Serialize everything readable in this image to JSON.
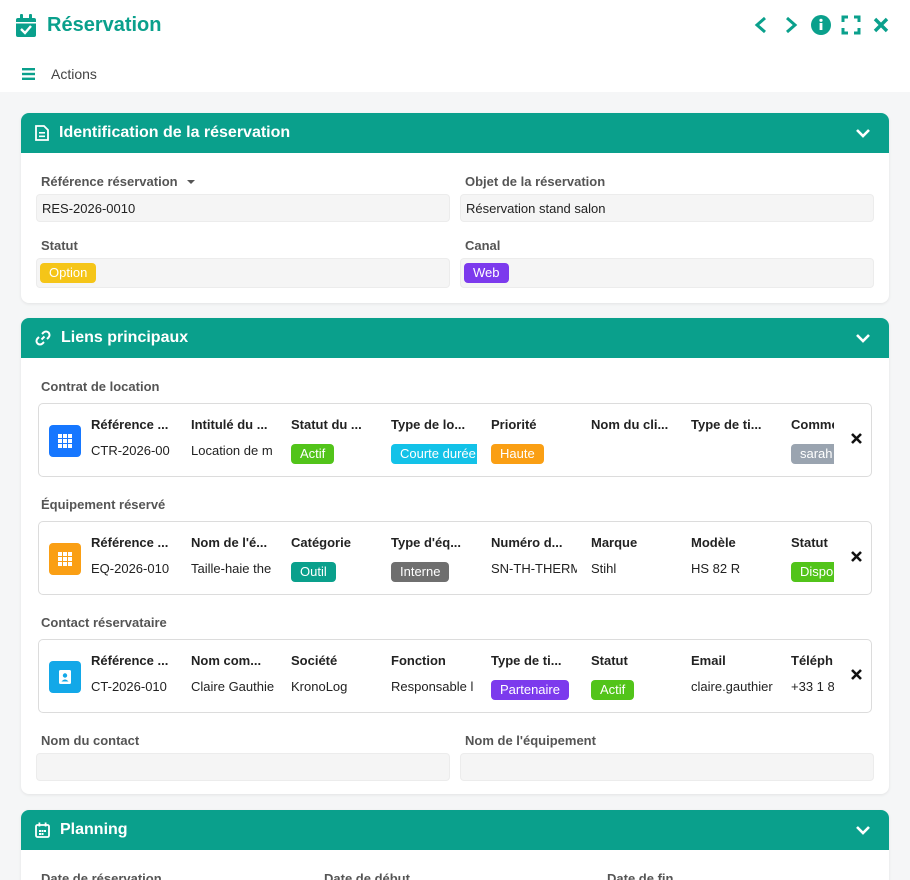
{
  "header": {
    "title": "Réservation",
    "actions_label": "Actions",
    "icons": [
      "calendar-check-icon",
      "chevron-left-icon",
      "chevron-right-icon",
      "info-icon",
      "expand-icon",
      "close-icon"
    ]
  },
  "colors": {
    "accent": "#0aa08c",
    "yellow": "#f5c518",
    "purple": "#7c3aed",
    "green": "#52c41a",
    "cyan": "#13c2e8",
    "orange": "#fa9f14",
    "gray": "#7a7a7a",
    "slate": "#9aa4b0",
    "blue": "#1677ff"
  },
  "identification": {
    "title": "Identification de la réservation",
    "ref_label": "Référence réservation",
    "ref_value": "RES-2026-0010",
    "objet_label": "Objet de la réservation",
    "objet_value": "Réservation stand salon",
    "statut_label": "Statut",
    "statut_value": "Option",
    "canal_label": "Canal",
    "canal_value": "Web"
  },
  "liens": {
    "title": "Liens principaux",
    "contrat": {
      "label": "Contrat de location",
      "columns": [
        {
          "h": "Référence ...",
          "v": "CTR-2026-00"
        },
        {
          "h": "Intitulé du ...",
          "v": "Location de m"
        },
        {
          "h": "Statut du ...",
          "badge": "Actif",
          "color": "#52c41a"
        },
        {
          "h": "Type de lo...",
          "badge": "Courte durée",
          "color": "#13c2e8"
        },
        {
          "h": "Priorité",
          "badge": "Haute",
          "color": "#fa9f14"
        },
        {
          "h": "Nom du cli...",
          "v": ""
        },
        {
          "h": "Type de ti...",
          "v": ""
        },
        {
          "h": "Comme",
          "badge": "sarah",
          "color": "#9aa4b0"
        }
      ]
    },
    "equipement": {
      "label": "Équipement réservé",
      "columns": [
        {
          "h": "Référence ...",
          "v": "EQ-2026-010"
        },
        {
          "h": "Nom de l'é...",
          "v": "Taille-haie the"
        },
        {
          "h": "Catégorie",
          "badge": "Outil",
          "color": "#0aa08c"
        },
        {
          "h": "Type d'éq...",
          "badge": "Interne",
          "color": "#6f6f6f"
        },
        {
          "h": "Numéro d...",
          "v": "SN-TH-THERM"
        },
        {
          "h": "Marque",
          "v": "Stihl"
        },
        {
          "h": "Modèle",
          "v": "HS 82 R"
        },
        {
          "h": "Statut",
          "badge": "Dispo",
          "color": "#52c41a"
        }
      ]
    },
    "contact": {
      "label": "Contact réservataire",
      "columns": [
        {
          "h": "Référence ...",
          "v": "CT-2026-010"
        },
        {
          "h": "Nom com...",
          "v": "Claire Gauthie"
        },
        {
          "h": "Société",
          "v": "KronoLog"
        },
        {
          "h": "Fonction",
          "v": "Responsable l"
        },
        {
          "h": "Type de ti...",
          "badge": "Partenaire",
          "color": "#7c3aed"
        },
        {
          "h": "Statut",
          "badge": "Actif",
          "color": "#52c41a"
        },
        {
          "h": "Email",
          "v": "claire.gauthier"
        },
        {
          "h": "Téléph",
          "v": "+33 1 8"
        }
      ]
    },
    "nom_contact_label": "Nom du contact",
    "nom_equipement_label": "Nom de l'équipement"
  },
  "planning": {
    "title": "Planning",
    "date_reservation_label": "Date de réservation",
    "date_debut_label": "Date de début",
    "date_fin_label": "Date de fin"
  }
}
